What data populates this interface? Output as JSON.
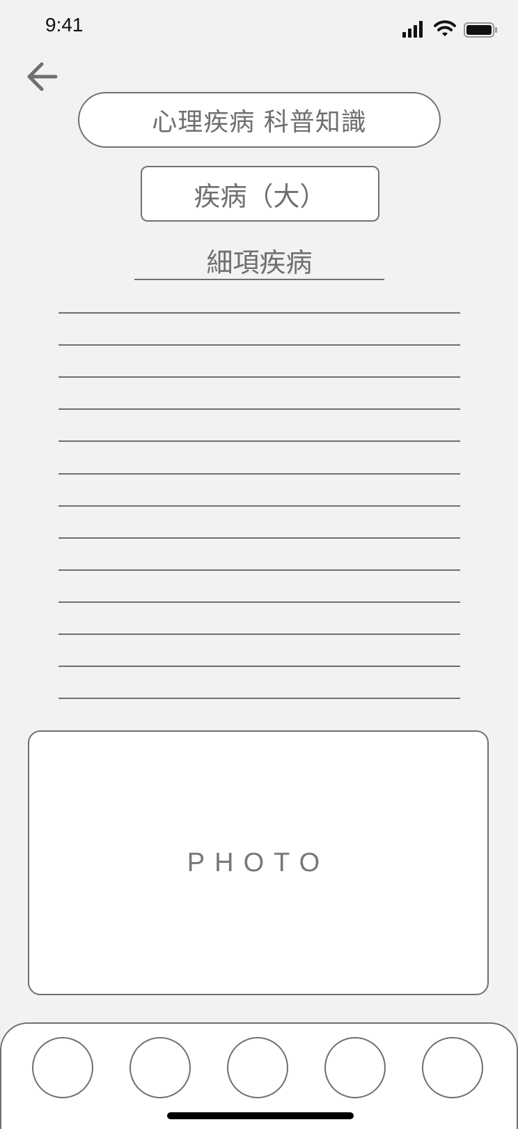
{
  "status_bar": {
    "time": "9:41"
  },
  "header": {
    "title": "心理疾病 科普知識",
    "category": "疾病（大）",
    "subtitle": "細項疾病"
  },
  "content": {
    "line_count": 13
  },
  "photo": {
    "label": "PHOTO"
  },
  "tab_bar": {
    "items": [
      "tab-1",
      "tab-2",
      "tab-3",
      "tab-4",
      "tab-5"
    ]
  },
  "colors": {
    "background": "#f3f1f2",
    "stroke": "#6f6f6f",
    "surface": "#ffffff"
  }
}
